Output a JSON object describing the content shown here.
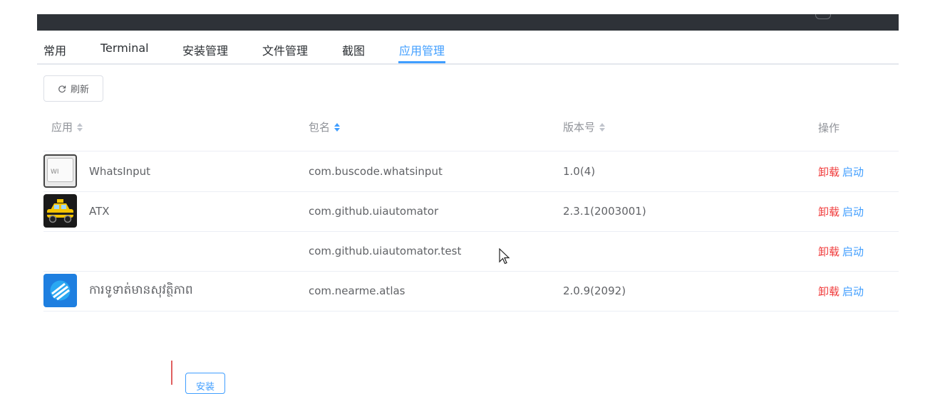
{
  "tabs": [
    {
      "label": "常用",
      "active": false
    },
    {
      "label": "Terminal",
      "active": false
    },
    {
      "label": "安装管理",
      "active": false
    },
    {
      "label": "文件管理",
      "active": false
    },
    {
      "label": "截图",
      "active": false
    },
    {
      "label": "应用管理",
      "active": true
    }
  ],
  "toolbar": {
    "refresh_label": "刷新"
  },
  "table": {
    "headers": {
      "app": "应用",
      "package": "包名",
      "version": "版本号",
      "actions": "操作"
    },
    "sort": {
      "app": "none",
      "package": "ascending",
      "version": "none"
    },
    "rows": [
      {
        "icon": "whatsinput-keyboard-icon",
        "app": "WhatsInput",
        "package": "com.buscode.whatsinput",
        "version": "1.0(4)",
        "uninstall": "卸载",
        "launch": "启动"
      },
      {
        "icon": "atx-taxi-icon",
        "app": "ATX",
        "package": "com.github.uiautomator",
        "version": "2.3.1(2003001)",
        "uninstall": "卸载",
        "launch": "启动"
      },
      {
        "icon": "",
        "app": "",
        "package": "com.github.uiautomator.test",
        "version": "",
        "uninstall": "卸载",
        "launch": "启动"
      },
      {
        "icon": "atlas-blue-icon",
        "app": "ការទូទាត់មានសុវត្ថិភាព",
        "package": "com.nearme.atlas",
        "version": "2.0.9(2092)",
        "uninstall": "卸载",
        "launch": "启动"
      }
    ]
  },
  "icon_text": {
    "whatsinput": "WI"
  },
  "bottom": {
    "install_label": "安装"
  },
  "colors": {
    "accent": "#409eff",
    "danger": "#f03c3c",
    "topbar": "#2e3238"
  }
}
